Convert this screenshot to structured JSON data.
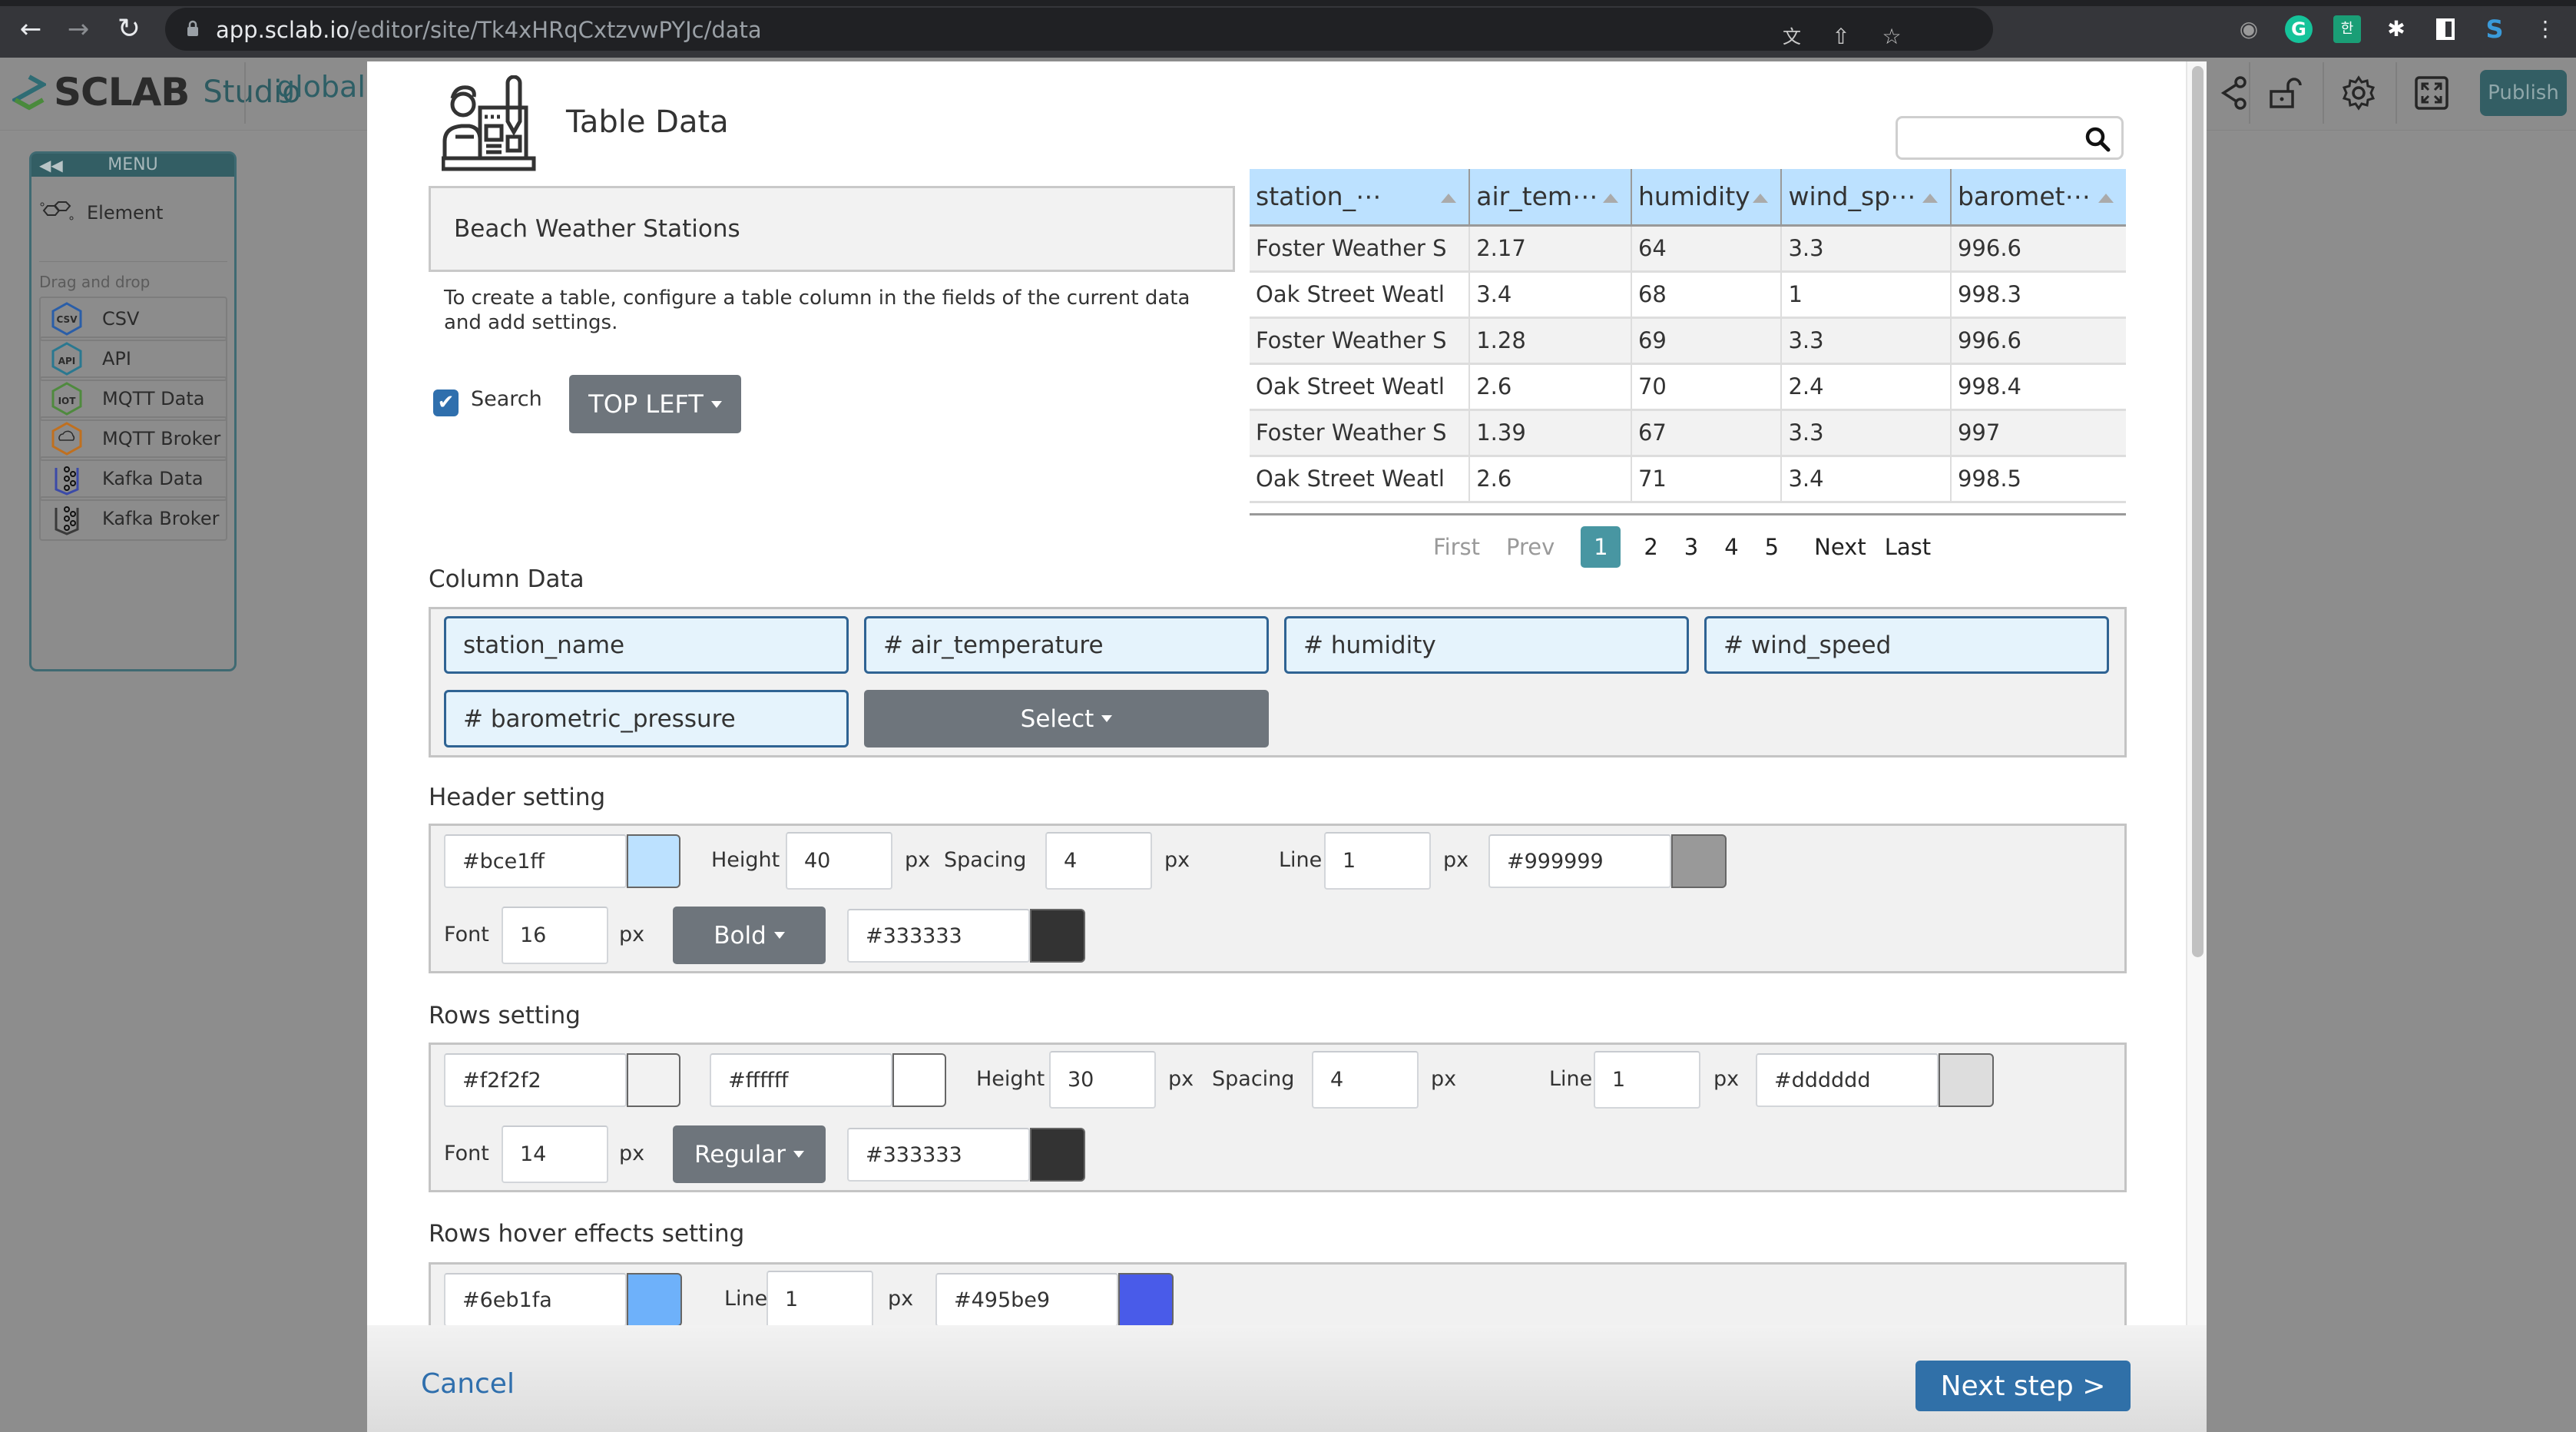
{
  "browser": {
    "url_host": "app.sclab.io",
    "url_path": "/editor/site/Tk4xHRqCxtzvwPYJc/data",
    "icons": [
      "back-icon",
      "forward-icon",
      "reload-icon",
      "lock-icon",
      "translate-icon",
      "share-icon",
      "bookmark-star-icon",
      "camera-extension-icon",
      "grammarly-extension-icon",
      "chatgpt-korean-extension-icon",
      "extensions-puzzle-icon",
      "sidepanel-icon",
      "sclab-extension-icon",
      "more-menu-icon"
    ]
  },
  "app": {
    "brand": "SCLAB",
    "product": "Studio",
    "site_name": "globalc",
    "toolbar": {
      "publish_label": "Publish",
      "icons": [
        "share-icon",
        "unlock-icon",
        "settings-gear-icon",
        "fullscreen-icon"
      ]
    }
  },
  "menu": {
    "title": "MENU",
    "element_label": "Element",
    "drag_caption": "Drag and drop",
    "items": [
      {
        "label": "CSV",
        "icon": "csv-hex-icon",
        "color": "#2a5ea8"
      },
      {
        "label": "API",
        "icon": "api-hex-icon",
        "color": "#2a7890"
      },
      {
        "label": "MQTT Data",
        "icon": "iot-hex-icon",
        "color": "#4f8a3e"
      },
      {
        "label": "MQTT Broker",
        "icon": "cloud-broker-hex-icon",
        "color": "#c0701f"
      },
      {
        "label": "Kafka Data",
        "icon": "kafka-hex-icon",
        "color": "#3b4aa8"
      },
      {
        "label": "Kafka Broker",
        "icon": "kafka-hex-icon",
        "color": "#3a3a3a"
      }
    ]
  },
  "dialog": {
    "title": "Table Data",
    "dataset_name": "Beach Weather Stations",
    "description": "To create a table, configure a table column in the fields of the current data and add settings.",
    "search_checkbox": {
      "label": "Search",
      "checked": true
    },
    "search_position": "TOP LEFT",
    "preview": {
      "search_value": "",
      "columns": [
        "station_⋯",
        "air_tem⋯",
        "humidity",
        "wind_sp⋯",
        "baromet⋯"
      ],
      "rows": [
        [
          "Foster Weather S",
          "2.17",
          "64",
          "3.3",
          "996.6"
        ],
        [
          "Oak Street Weatl",
          "3.4",
          "68",
          "1",
          "998.3"
        ],
        [
          "Foster Weather S",
          "1.28",
          "69",
          "3.3",
          "996.6"
        ],
        [
          "Oak Street Weatl",
          "2.6",
          "70",
          "2.4",
          "998.4"
        ],
        [
          "Foster Weather S",
          "1.39",
          "67",
          "3.3",
          "997"
        ],
        [
          "Oak Street Weatl",
          "2.6",
          "71",
          "3.4",
          "998.5"
        ]
      ],
      "pagination": {
        "first": "First",
        "prev": "Prev",
        "pages": [
          "1",
          "2",
          "3",
          "4",
          "5"
        ],
        "current": "1",
        "next": "Next",
        "last": "Last"
      }
    },
    "column_data": {
      "label": "Column Data",
      "fields": [
        "station_name",
        "# air_temperature",
        "# humidity",
        "# wind_speed",
        "# barometric_pressure"
      ],
      "select_label": "Select"
    },
    "header_setting": {
      "label": "Header setting",
      "bg_color": "#bce1ff",
      "height_label": "Height",
      "height": "40",
      "spacing_label": "Spacing",
      "spacing": "4",
      "line_label": "Line",
      "line": "1",
      "line_color": "#999999",
      "font_label": "Font",
      "font_size": "16",
      "font_weight": "Bold",
      "font_color": "#333333",
      "unit": "px"
    },
    "rows_setting": {
      "label": "Rows setting",
      "odd_color": "#f2f2f2",
      "even_color": "#ffffff",
      "height_label": "Height",
      "height": "30",
      "spacing_label": "Spacing",
      "spacing": "4",
      "line_label": "Line",
      "line": "1",
      "line_color": "#dddddd",
      "font_label": "Font",
      "font_size": "14",
      "font_weight": "Regular",
      "font_color": "#333333",
      "unit": "px"
    },
    "hover_setting": {
      "label": "Rows hover effects setting",
      "bg_color": "#6eb1fa",
      "line_label": "Line",
      "line": "1",
      "line_color": "#495be9",
      "unit": "px"
    },
    "footer": {
      "cancel_label": "Cancel",
      "next_label": "Next step >"
    }
  }
}
